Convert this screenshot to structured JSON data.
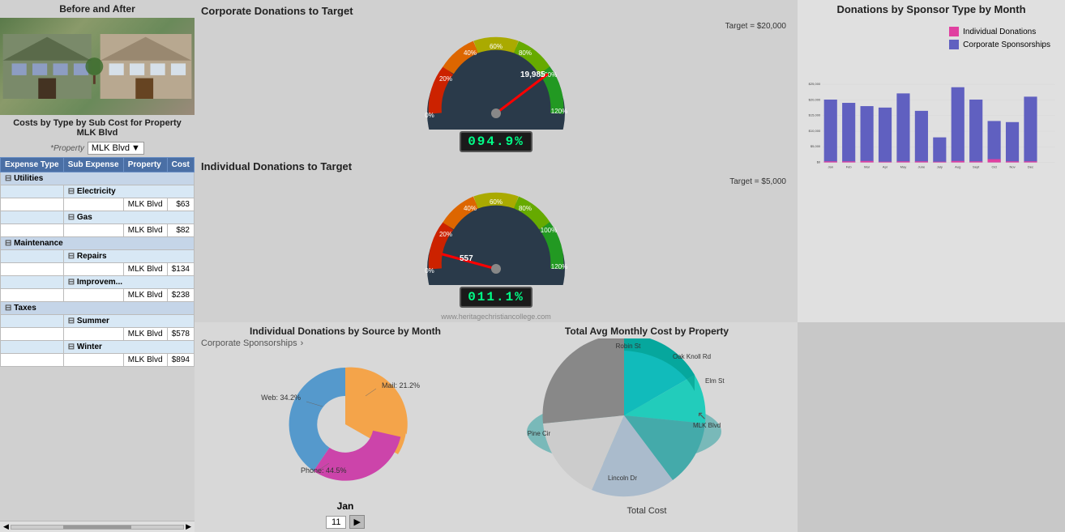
{
  "left": {
    "corporate": {
      "title": "Corporate Donations to Target",
      "target_label": "Target = $20,000",
      "readout": "094.9%",
      "pct": 94.9
    },
    "individual": {
      "title": "Individual Donations to Target",
      "target_label": "Target = $5,000",
      "readout": "011.1%",
      "pct": 11.1
    },
    "watermark": "www.heritagechristiancollege.com"
  },
  "center_top": {
    "title": "Donations by Sponsor Type by Month",
    "legend": {
      "individual_label": "Individual Donations",
      "individual_color": "#e040a0",
      "corporate_label": "Corporate Sponsorships",
      "corporate_color": "#6060c0"
    },
    "y_labels": [
      "$25,000",
      "$20,000",
      "$15,000",
      "$10,000",
      "$5,000",
      "$0"
    ],
    "months": [
      "Jan",
      "Feb",
      "Mar",
      "Apr",
      "May",
      "June",
      "July",
      "Aug",
      "Sept",
      "Oct",
      "Nov",
      "Dec"
    ],
    "corporate_bars": [
      19000,
      18000,
      17000,
      16500,
      21000,
      15500,
      8500,
      23000,
      19000,
      12500,
      12000,
      20500
    ],
    "individual_bars": [
      400,
      300,
      500,
      200,
      400,
      300,
      200,
      500,
      300,
      1000,
      400,
      300
    ]
  },
  "center_bottom_left": {
    "title": "Individual Donations by Source by Month",
    "corp_link": "Corporate Sponsorships",
    "month_label": "Jan",
    "segments": [
      {
        "label": "Mail: 21.2%",
        "value": 21.2,
        "color": "#5599cc"
      },
      {
        "label": "Web: 34.2%",
        "value": 34.2,
        "color": "#cc44aa"
      },
      {
        "label": "Phone: 44.5%",
        "value": 44.5,
        "color": "#f4a44a"
      }
    ]
  },
  "center_bottom_right": {
    "title": "Total Avg Monthly Cost by Property",
    "total_cost_label": "Total Cost",
    "segments": [
      {
        "label": "Robin St",
        "color": "#888888"
      },
      {
        "label": "Oak Knoll Rd",
        "color": "#aabbcc"
      },
      {
        "label": "Elm St",
        "color": "#44aaaa"
      },
      {
        "label": "MLK Blvd",
        "color": "#22ccbb"
      },
      {
        "label": "Lincoln Dr",
        "color": "#11bbbb"
      },
      {
        "label": "Pine Cir",
        "color": "#cccccc"
      }
    ]
  },
  "page_nav": {
    "page_number": "11",
    "next_label": "▶"
  },
  "right": {
    "before_after_title": "Before and After",
    "costs_title": "Costs by Type by Sub Cost for Property MLK Blvd",
    "property_label": "*Property",
    "property_value": "MLK Blvd",
    "table_headers": [
      "Expense Type",
      "Sub Expense",
      "Property",
      "Cost"
    ],
    "rows": [
      {
        "type": "section",
        "label": "Utilities",
        "colspan": 4
      },
      {
        "type": "subsection",
        "label": "Electricity"
      },
      {
        "type": "data",
        "expense": "",
        "sub": "",
        "property": "MLK Blvd",
        "cost": "$63"
      },
      {
        "type": "subsection",
        "label": "Gas"
      },
      {
        "type": "data",
        "expense": "",
        "sub": "",
        "property": "MLK Blvd",
        "cost": "$82"
      },
      {
        "type": "section",
        "label": "Maintenance",
        "colspan": 4
      },
      {
        "type": "subsection",
        "label": "Repairs"
      },
      {
        "type": "data",
        "expense": "",
        "sub": "",
        "property": "MLK Blvd",
        "cost": "$134"
      },
      {
        "type": "subsection",
        "label": "Improvem..."
      },
      {
        "type": "data",
        "expense": "",
        "sub": "",
        "property": "MLK Blvd",
        "cost": "$238"
      },
      {
        "type": "section",
        "label": "Taxes",
        "colspan": 4
      },
      {
        "type": "subsection",
        "label": "Summer"
      },
      {
        "type": "data",
        "expense": "",
        "sub": "",
        "property": "MLK Blvd",
        "cost": "$578"
      },
      {
        "type": "subsection",
        "label": "Winter"
      },
      {
        "type": "data",
        "expense": "",
        "sub": "",
        "property": "MLK Blvd",
        "cost": "$894"
      }
    ]
  }
}
